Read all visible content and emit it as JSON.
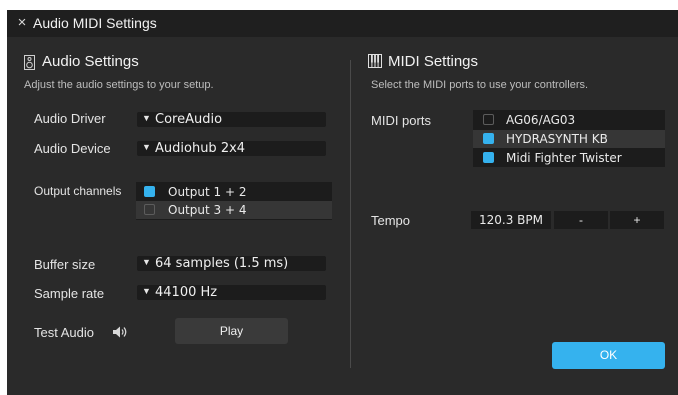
{
  "window": {
    "title": "Audio MIDI Settings",
    "close_glyph": "×"
  },
  "audio": {
    "heading": "Audio Settings",
    "icon": "speaker-icon",
    "subtitle": "Adjust the audio settings to your setup.",
    "driver_label": "Audio Driver",
    "driver_value": "CoreAudio",
    "device_label": "Audio Device",
    "device_value": "Audiohub 2x4",
    "outputs_label": "Output channels",
    "outputs": [
      {
        "label": "Output 1 + 2",
        "checked": true
      },
      {
        "label": "Output 3 + 4",
        "checked": false
      }
    ],
    "buffer_label": "Buffer size",
    "buffer_value": "64 samples (1.5 ms)",
    "rate_label": "Sample rate",
    "rate_value": "44100 Hz",
    "test_label": "Test Audio",
    "test_icon": "volume-icon",
    "play_label": "Play"
  },
  "midi": {
    "heading": "MIDI Settings",
    "icon": "piano-keys-icon",
    "subtitle": "Select the MIDI ports to use your controllers.",
    "ports_label": "MIDI ports",
    "ports": [
      {
        "label": "AG06/AG03",
        "checked": false
      },
      {
        "label": "HYDRASYNTH KB",
        "checked": true
      },
      {
        "label": "Midi Fighter Twister",
        "checked": true
      }
    ],
    "tempo_label": "Tempo",
    "tempo_value": "120.3 BPM",
    "tempo_minus": "-",
    "tempo_plus": "+"
  },
  "ok_label": "OK",
  "colors": {
    "accent": "#35b2ee",
    "panel": "#2a2a2a",
    "field": "#1c1c1c"
  }
}
